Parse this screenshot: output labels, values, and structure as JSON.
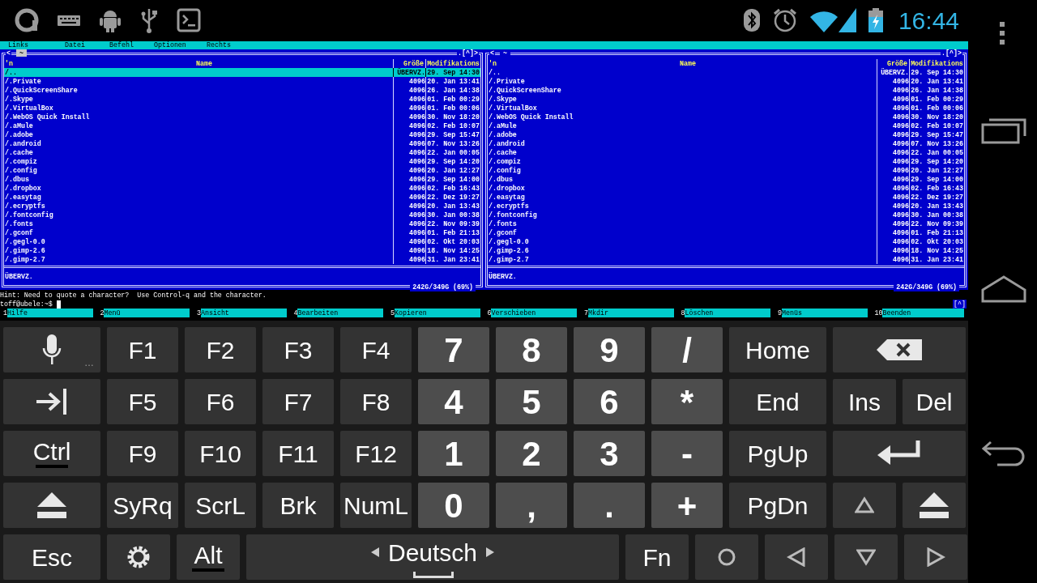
{
  "status_bar": {
    "time": "16:44"
  },
  "menu_bar": [
    "Links",
    "Datei",
    "Befehl",
    "Optionen",
    "Rechts"
  ],
  "panels": [
    {
      "left_mark": "<",
      "path": "~",
      "path_active": true,
      "right_mark": ".[^]>",
      "columns": [
        "'n",
        "Name",
        "Größe",
        "Modifikations"
      ],
      "footer": "ÜBERVZ.",
      "disk": "242G/349G (69%)",
      "rows": [
        {
          "name": "/..",
          "size": "ÜBERVZ.",
          "modified": "29. Sep 14:30",
          "selected": true
        },
        {
          "name": "/.Private",
          "size": "4096",
          "modified": "20. Jan 13:41",
          "selected": false
        },
        {
          "name": "/.QuickScreenShare",
          "size": "4096",
          "modified": "26. Jan 14:38",
          "selected": false
        },
        {
          "name": "/.Skype",
          "size": "4096",
          "modified": "01. Feb 00:29",
          "selected": false
        },
        {
          "name": "/.VirtualBox",
          "size": "4096",
          "modified": "01. Feb 00:06",
          "selected": false
        },
        {
          "name": "/.WebOS Quick Install",
          "size": "4096",
          "modified": "30. Nov 18:20",
          "selected": false
        },
        {
          "name": "/.aMule",
          "size": "4096",
          "modified": "02. Feb 10:07",
          "selected": false
        },
        {
          "name": "/.adobe",
          "size": "4096",
          "modified": "29. Sep 15:47",
          "selected": false
        },
        {
          "name": "/.android",
          "size": "4096",
          "modified": "07. Nov 13:26",
          "selected": false
        },
        {
          "name": "/.cache",
          "size": "4096",
          "modified": "22. Jan 00:05",
          "selected": false
        },
        {
          "name": "/.compiz",
          "size": "4096",
          "modified": "29. Sep 14:20",
          "selected": false
        },
        {
          "name": "/.config",
          "size": "4096",
          "modified": "20. Jan 12:27",
          "selected": false
        },
        {
          "name": "/.dbus",
          "size": "4096",
          "modified": "29. Sep 14:00",
          "selected": false
        },
        {
          "name": "/.dropbox",
          "size": "4096",
          "modified": "02. Feb 16:43",
          "selected": false
        },
        {
          "name": "/.easytag",
          "size": "4096",
          "modified": "22. Dez 19:27",
          "selected": false
        },
        {
          "name": "/.ecryptfs",
          "size": "4096",
          "modified": "20. Jan 13:43",
          "selected": false
        },
        {
          "name": "/.fontconfig",
          "size": "4096",
          "modified": "30. Jan 00:38",
          "selected": false
        },
        {
          "name": "/.fonts",
          "size": "4096",
          "modified": "22. Nov 09:39",
          "selected": false
        },
        {
          "name": "/.gconf",
          "size": "4096",
          "modified": "01. Feb 21:13",
          "selected": false
        },
        {
          "name": "/.gegl-0.0",
          "size": "4096",
          "modified": "02. Okt 20:03",
          "selected": false
        },
        {
          "name": "/.gimp-2.6",
          "size": "4096",
          "modified": "18. Nov 14:25",
          "selected": false
        },
        {
          "name": "/.gimp-2.7",
          "size": "4096",
          "modified": "31. Jan 23:41",
          "selected": false
        }
      ]
    },
    {
      "left_mark": "<",
      "path": "~",
      "path_active": false,
      "right_mark": ".[^]>",
      "columns": [
        "'n",
        "Name",
        "Größe",
        "Modifikations"
      ],
      "footer": "ÜBERVZ.",
      "disk": "242G/349G (69%)",
      "rows": [
        {
          "name": "/..",
          "size": "ÜBERVZ.",
          "modified": "29. Sep 14:30",
          "selected": false
        },
        {
          "name": "/.Private",
          "size": "4096",
          "modified": "20. Jan 13:41",
          "selected": false
        },
        {
          "name": "/.QuickScreenShare",
          "size": "4096",
          "modified": "26. Jan 14:38",
          "selected": false
        },
        {
          "name": "/.Skype",
          "size": "4096",
          "modified": "01. Feb 00:29",
          "selected": false
        },
        {
          "name": "/.VirtualBox",
          "size": "4096",
          "modified": "01. Feb 00:06",
          "selected": false
        },
        {
          "name": "/.WebOS Quick Install",
          "size": "4096",
          "modified": "30. Nov 18:20",
          "selected": false
        },
        {
          "name": "/.aMule",
          "size": "4096",
          "modified": "02. Feb 10:07",
          "selected": false
        },
        {
          "name": "/.adobe",
          "size": "4096",
          "modified": "29. Sep 15:47",
          "selected": false
        },
        {
          "name": "/.android",
          "size": "4096",
          "modified": "07. Nov 13:26",
          "selected": false
        },
        {
          "name": "/.cache",
          "size": "4096",
          "modified": "22. Jan 00:05",
          "selected": false
        },
        {
          "name": "/.compiz",
          "size": "4096",
          "modified": "29. Sep 14:20",
          "selected": false
        },
        {
          "name": "/.config",
          "size": "4096",
          "modified": "20. Jan 12:27",
          "selected": false
        },
        {
          "name": "/.dbus",
          "size": "4096",
          "modified": "29. Sep 14:00",
          "selected": false
        },
        {
          "name": "/.dropbox",
          "size": "4096",
          "modified": "02. Feb 16:43",
          "selected": false
        },
        {
          "name": "/.easytag",
          "size": "4096",
          "modified": "22. Dez 19:27",
          "selected": false
        },
        {
          "name": "/.ecryptfs",
          "size": "4096",
          "modified": "20. Jan 13:43",
          "selected": false
        },
        {
          "name": "/.fontconfig",
          "size": "4096",
          "modified": "30. Jan 00:38",
          "selected": false
        },
        {
          "name": "/.fonts",
          "size": "4096",
          "modified": "22. Nov 09:39",
          "selected": false
        },
        {
          "name": "/.gconf",
          "size": "4096",
          "modified": "01. Feb 21:13",
          "selected": false
        },
        {
          "name": "/.gegl-0.0",
          "size": "4096",
          "modified": "02. Okt 20:03",
          "selected": false
        },
        {
          "name": "/.gimp-2.6",
          "size": "4096",
          "modified": "18. Nov 14:25",
          "selected": false
        },
        {
          "name": "/.gimp-2.7",
          "size": "4096",
          "modified": "31. Jan 23:41",
          "selected": false
        }
      ]
    }
  ],
  "hint": "Hint: Need to quote a character?  Use Control-q and the character.",
  "prompt": "toff@ubele:~$",
  "corner_mark": "[^]",
  "function_keys": [
    {
      "number": "1",
      "label": "Hilfe"
    },
    {
      "number": "2",
      "label": "Menü"
    },
    {
      "number": "3",
      "label": "Ansicht"
    },
    {
      "number": "4",
      "label": "Bearbeiten"
    },
    {
      "number": "5",
      "label": "Kopieren"
    },
    {
      "number": "6",
      "label": "Verschieben"
    },
    {
      "number": "7",
      "label": "Mkdir"
    },
    {
      "number": "8",
      "label": "Löschen"
    },
    {
      "number": "9",
      "label": "Menüs"
    },
    {
      "number": "10",
      "label": "Beenden"
    }
  ],
  "keyboard": [
    [
      {
        "kind": "mic",
        "label": "…"
      },
      {
        "kind": "function",
        "label": "F1"
      },
      {
        "kind": "function",
        "label": "F2"
      },
      {
        "kind": "function",
        "label": "F3"
      },
      {
        "kind": "function",
        "label": "F4"
      },
      {
        "kind": "digit",
        "label": "7"
      },
      {
        "kind": "digit",
        "label": "8"
      },
      {
        "kind": "digit",
        "label": "9"
      },
      {
        "kind": "digit",
        "label": "/"
      },
      {
        "kind": "nav",
        "label": "Home"
      },
      {
        "kind": "backspace"
      }
    ],
    [
      {
        "kind": "tab"
      },
      {
        "kind": "function",
        "label": "F5"
      },
      {
        "kind": "function",
        "label": "F6"
      },
      {
        "kind": "function",
        "label": "F7"
      },
      {
        "kind": "function",
        "label": "F8"
      },
      {
        "kind": "digit",
        "label": "4"
      },
      {
        "kind": "digit",
        "label": "5"
      },
      {
        "kind": "digit",
        "label": "6"
      },
      {
        "kind": "digit",
        "label": "*"
      },
      {
        "kind": "nav",
        "label": "End"
      },
      {
        "kind": "small",
        "label": "Ins"
      },
      {
        "kind": "small",
        "label": "Del"
      }
    ],
    [
      {
        "kind": "modifier",
        "label": "Ctrl"
      },
      {
        "kind": "function",
        "label": "F9"
      },
      {
        "kind": "function",
        "label": "F10"
      },
      {
        "kind": "function",
        "label": "F11"
      },
      {
        "kind": "function",
        "label": "F12"
      },
      {
        "kind": "digit",
        "label": "1"
      },
      {
        "kind": "digit",
        "label": "2"
      },
      {
        "kind": "digit",
        "label": "3"
      },
      {
        "kind": "digit",
        "label": "-"
      },
      {
        "kind": "nav",
        "label": "PgUp"
      },
      {
        "kind": "enter"
      }
    ],
    [
      {
        "kind": "shift"
      },
      {
        "kind": "function",
        "label": "SyRq"
      },
      {
        "kind": "function",
        "label": "ScrL"
      },
      {
        "kind": "function",
        "label": "Brk"
      },
      {
        "kind": "function",
        "label": "NumL"
      },
      {
        "kind": "digit",
        "label": "0"
      },
      {
        "kind": "digit",
        "label": ","
      },
      {
        "kind": "digit",
        "label": "."
      },
      {
        "kind": "digit",
        "label": "+"
      },
      {
        "kind": "nav",
        "label": "PgDn"
      },
      {
        "kind": "up"
      },
      {
        "kind": "shift_small"
      }
    ],
    [
      {
        "kind": "nav",
        "label": "Esc"
      },
      {
        "kind": "gear"
      },
      {
        "kind": "modifier_small",
        "label": "Alt"
      },
      {
        "kind": "space",
        "label": "Deutsch"
      },
      {
        "kind": "small",
        "label": "Fn"
      },
      {
        "kind": "circle"
      },
      {
        "kind": "left"
      },
      {
        "kind": "down"
      },
      {
        "kind": "right"
      }
    ]
  ]
}
